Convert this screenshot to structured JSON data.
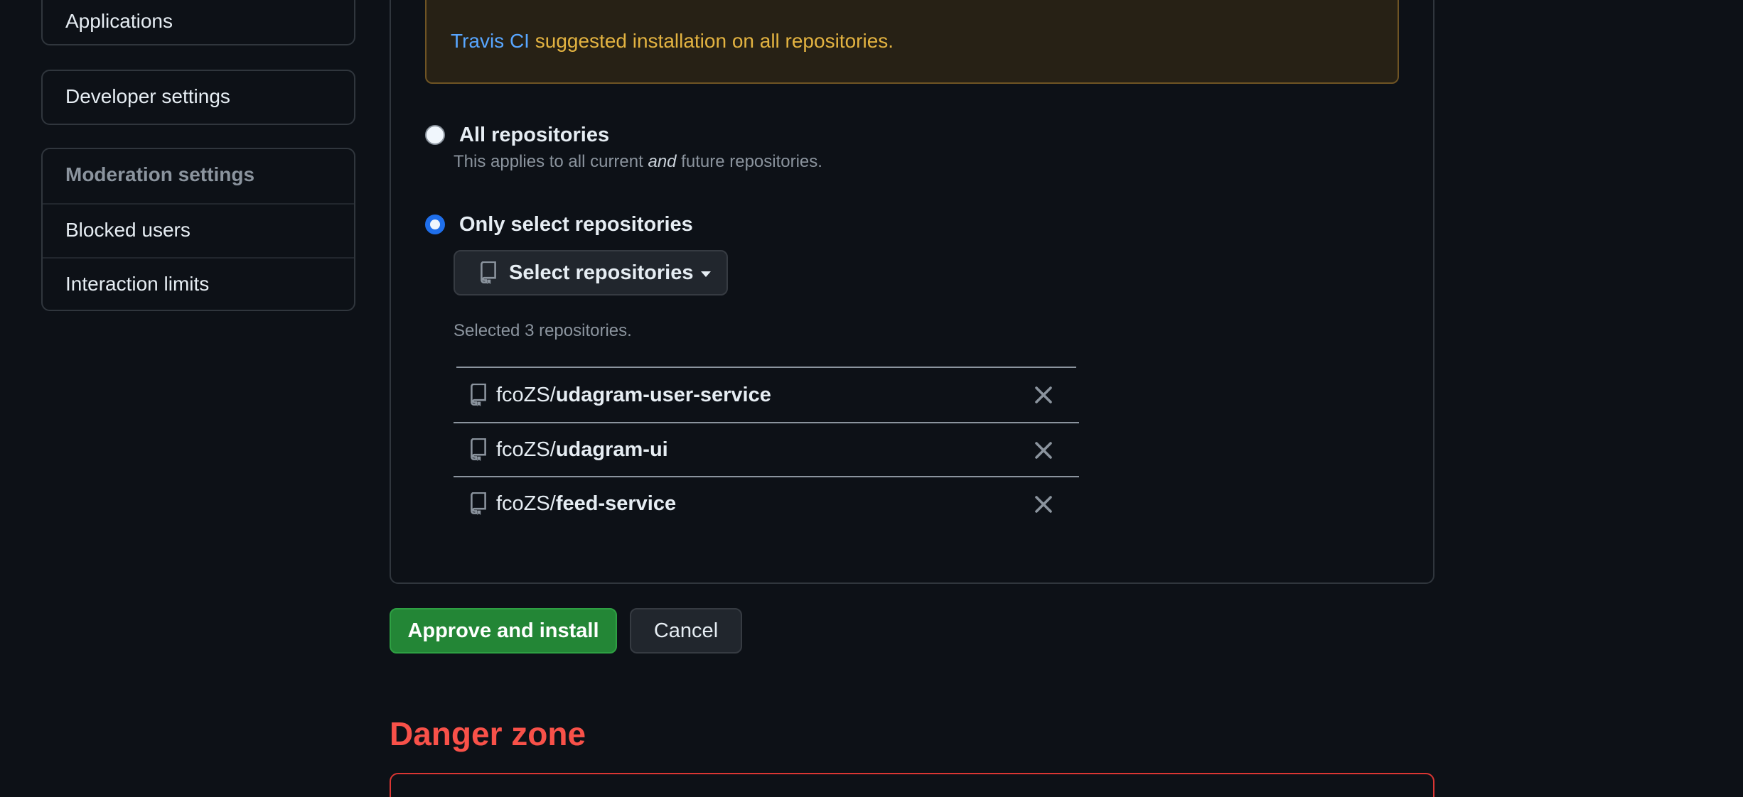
{
  "sidebar": {
    "applications": "Applications",
    "developer_settings": "Developer settings",
    "moderation": {
      "heading": "Moderation settings",
      "items": [
        "Blocked users",
        "Interaction limits"
      ]
    }
  },
  "notice": {
    "app_name": "Travis CI",
    "text": " suggested installation on all repositories."
  },
  "access": {
    "all": {
      "label": "All repositories",
      "note_before": "This applies to all current ",
      "note_emphasis": "and",
      "note_after": " future repositories.",
      "selected": false
    },
    "select": {
      "label": "Only select repositories",
      "selected": true
    }
  },
  "select_button": {
    "label": "Select repositories",
    "icon": "repo-icon"
  },
  "selected_count_text": "Selected 3 repositories.",
  "repositories": [
    {
      "owner": "fcoZS/",
      "name": "udagram-user-service"
    },
    {
      "owner": "fcoZS/",
      "name": "udagram-ui"
    },
    {
      "owner": "fcoZS/",
      "name": "feed-service"
    }
  ],
  "actions": {
    "approve": "Approve and install",
    "cancel": "Cancel"
  },
  "danger_zone": {
    "title": "Danger zone"
  },
  "colors": {
    "background": "#0d1117",
    "link": "#58a6ff",
    "warning_text": "#e3b341",
    "primary_button": "#238636",
    "danger": "#f85149",
    "radio_selected": "#1f6feb"
  }
}
